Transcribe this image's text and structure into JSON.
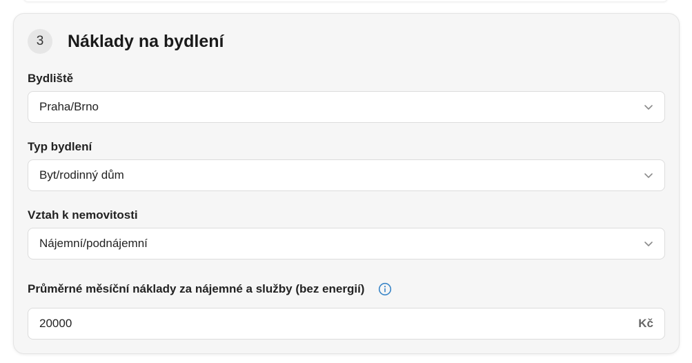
{
  "section": {
    "step_number": "3",
    "title": "Náklady na bydlení"
  },
  "fields": {
    "residence": {
      "label": "Bydliště",
      "value": "Praha/Brno"
    },
    "housing_type": {
      "label": "Typ bydlení",
      "value": "Byt/rodinný dům"
    },
    "property_relation": {
      "label": "Vztah k nemovitosti",
      "value": "Nájemní/podnájemní"
    },
    "monthly_costs": {
      "label": "Průměrné měsíční náklady za nájemné a služby (bez energií)",
      "value": "20000",
      "unit": "Kč"
    }
  },
  "icons": {
    "chevron": "chevron-down-icon",
    "info": "info-icon"
  },
  "colors": {
    "card_background": "#f6f6f6",
    "info_accent": "#3a86c8",
    "chevron": "#8a8a8a"
  }
}
